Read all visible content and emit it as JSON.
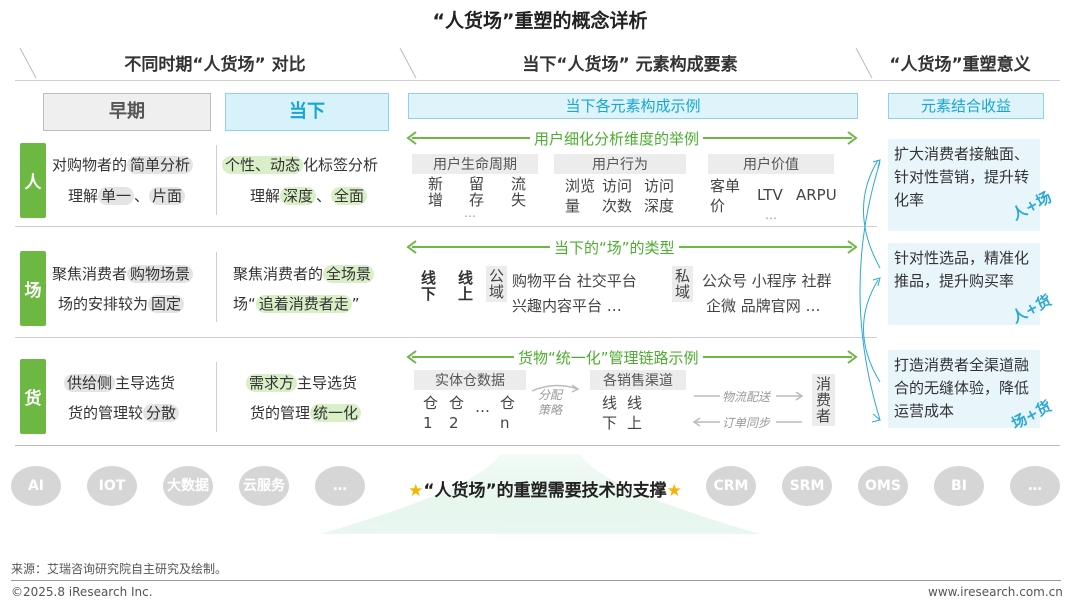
{
  "title": "“人货场”重塑的概念详析",
  "sections": {
    "left": "不同时期“人货场” 对比",
    "middle": "当下“人货场” 元素构成要素",
    "right": "“人货场”重塑意义"
  },
  "headers": {
    "early": "早期",
    "now": "当下",
    "elements": "当下各元素构成示例",
    "benefit": "元素结合收益"
  },
  "rows": {
    "person": {
      "label": "人",
      "early_a": "对购物者的",
      "early_a_hl": "简单分析",
      "early_b": "理解",
      "early_b_hl1": "单一",
      "early_b_sep": "、",
      "early_b_hl2": "片面",
      "now_a_hl": "个性、动态",
      "now_a": "化标签分析",
      "now_b": "理解",
      "now_b_hl1": "深度",
      "now_b_sep": "、",
      "now_b_hl2": "全面",
      "arrow_label": "用户细化分析维度的举例",
      "groups": [
        {
          "head": "用户生命周期",
          "items": [
            "新增",
            "留存",
            "流失"
          ],
          "more": "…"
        },
        {
          "head": "用户行为",
          "items": [
            "浏览量",
            "访问次数",
            "访问深度"
          ]
        },
        {
          "head": "用户价值",
          "items": [
            "客单价",
            "LTV",
            "ARPU"
          ],
          "more": "…"
        }
      ],
      "benefit": "扩大消费者接触面、针对性营销，提升转化率",
      "tag": "人+场"
    },
    "place": {
      "label": "场",
      "early_a": "聚焦消费者",
      "early_a_hl": "购物场景",
      "early_b": "场的安排较为",
      "early_b_hl": "固定",
      "now_a": "聚焦消费者的",
      "now_a_hl": "全场景",
      "now_b": "场“",
      "now_b_hl": "追着消费者走",
      "now_b_end": "”",
      "arrow_label": "当下的“场”的类型",
      "offline": "线下",
      "online": "线上",
      "public": "公域",
      "public_items1": "购物平台 社交平台",
      "public_items2": "兴趣内容平台 …",
      "private": "私域",
      "private_items1": "公众号 小程序 社群",
      "private_items2": "企微 品牌官网 …",
      "benefit": "针对性选品，精准化推品，提升购买率",
      "tag": "人+货"
    },
    "goods": {
      "label": "货",
      "early_a_hl": "供给侧",
      "early_a": "主导选货",
      "early_b": "货的管理较",
      "early_b_hl": "分散",
      "now_a_hl": "需求方",
      "now_a": "主导选货",
      "now_b": "货的管理",
      "now_b_hl": "统一化",
      "arrow_label": "货物“统一化”管理链路示例",
      "warehouse": "实体仓数据",
      "wh_items": [
        "仓1",
        "仓2",
        "…",
        "仓n"
      ],
      "allocate": "分配策略",
      "channels": "各销售渠道",
      "ch_items": [
        "线下",
        "线上"
      ],
      "logistics": "物流配送",
      "order_sync": "订单同步",
      "consumer": "消费者",
      "benefit": "打造消费者全渠道融合的无缝体验，降低运营成本",
      "tag": "场+货"
    }
  },
  "tech": {
    "support": "“人货场”的重塑需要技术的支撑",
    "left": [
      "AI",
      "IOT",
      "大数据",
      "云服务",
      "…"
    ],
    "right": [
      "CRM",
      "SRM",
      "OMS",
      "BI",
      "…"
    ]
  },
  "footer": {
    "source": "来源：艾瑞咨询研究院自主研究及绘制。",
    "copyright": "©2025.8 iResearch Inc.",
    "site": "www.iresearch.com.cn"
  },
  "colors": {
    "green": "#6db842",
    "blue": "#16a6d4",
    "gray": "#d6d6d6"
  }
}
